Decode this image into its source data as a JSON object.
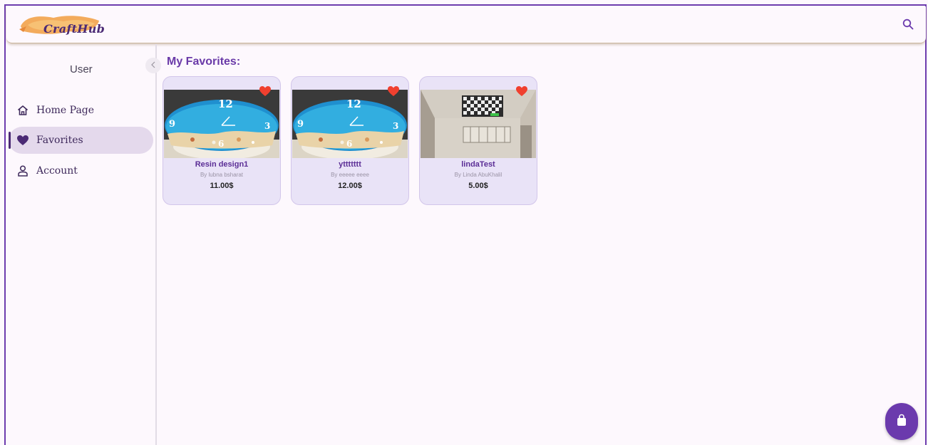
{
  "app": {
    "logo_text": "CraftHub",
    "brand_color": "#6b3aad"
  },
  "header": {
    "search_icon": "search-icon"
  },
  "sidebar": {
    "user_label": "User",
    "collapse_icon": "chevron-left-icon",
    "items": [
      {
        "label": "Home Page",
        "icon": "home-icon",
        "active": false
      },
      {
        "label": "Favorites",
        "icon": "heart-icon",
        "active": true
      },
      {
        "label": "Account",
        "icon": "person-icon",
        "active": false
      }
    ]
  },
  "main": {
    "title": "My Favorites:",
    "products": [
      {
        "title": "Resin design1",
        "author": "By lubna bsharat",
        "price": "11.00$",
        "image": "resin-clock",
        "favorited": true
      },
      {
        "title": "yttttttt",
        "author": "By eeeee eeee",
        "price": "12.00$",
        "image": "resin-clock",
        "favorited": true
      },
      {
        "title": "lindaTest",
        "author": "By Linda AbuKhalil",
        "price": "5.00$",
        "image": "room-ceiling",
        "favorited": true
      }
    ]
  },
  "fab": {
    "icon": "shopping-bag-icon"
  }
}
